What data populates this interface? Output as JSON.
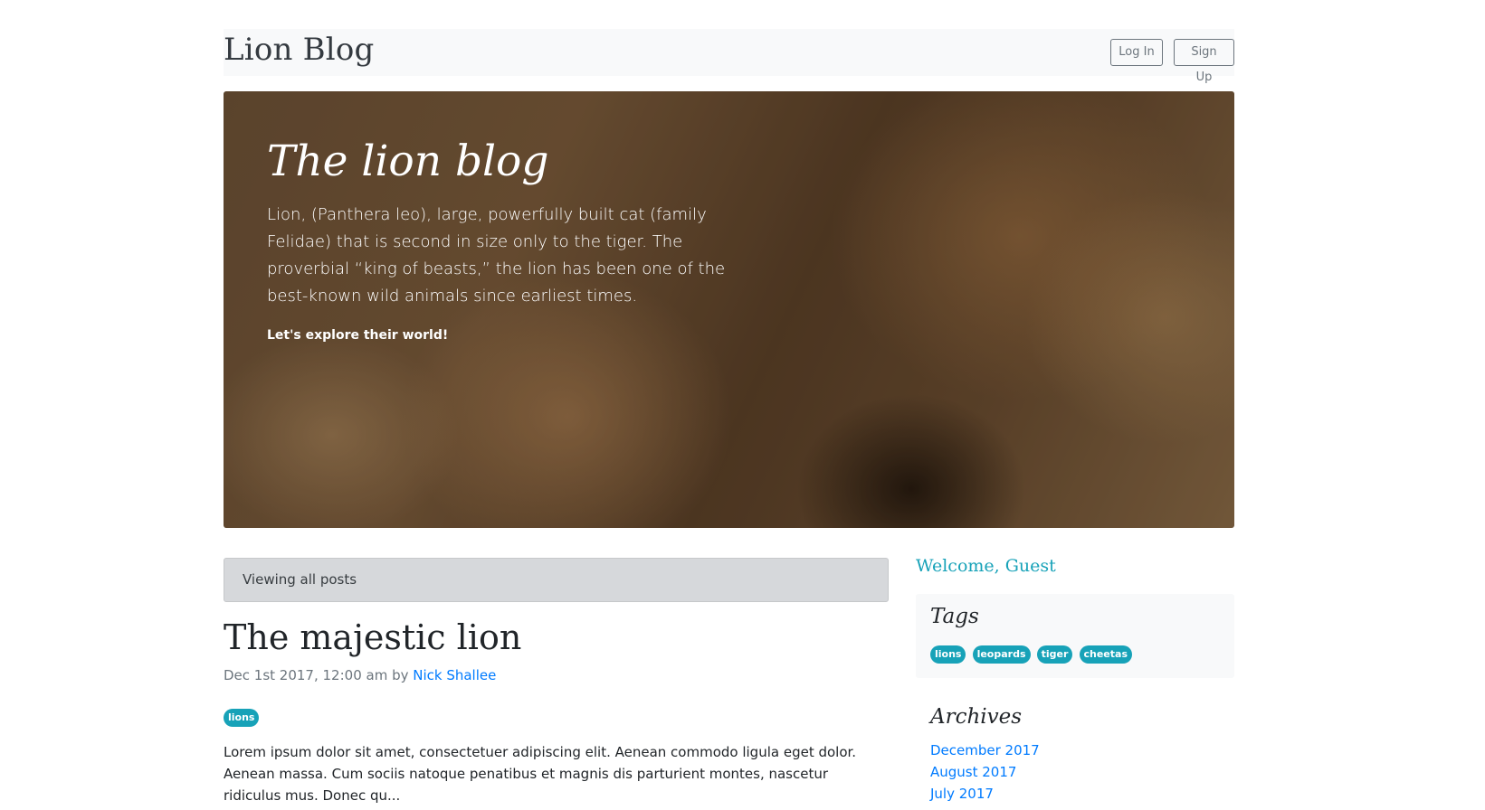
{
  "header": {
    "brand": "Lion Blog",
    "login_label": "Log In",
    "signup_label": "Sign Up"
  },
  "hero": {
    "title": "The lion blog",
    "text": "Lion, (Panthera leo), large, powerfully built cat (family Felidae) that is second in size only to the tiger. The proverbial “king of beasts,” the lion has been one of the best-known wild animals since earliest times.",
    "cta": "Let's explore their world!"
  },
  "main": {
    "viewing_text": "Viewing all posts",
    "post": {
      "title": "The majestic lion",
      "date": "Dec 1st 2017, 12:00 am by ",
      "author": "Nick Shallee",
      "tag": "lions",
      "excerpt": "Lorem ipsum dolor sit amet, consectetuer adipiscing elit. Aenean commodo ligula eget dolor. Aenean massa. Cum sociis natoque penatibus et magnis dis parturient montes, nascetur ridiculus mus. Donec qu..."
    }
  },
  "sidebar": {
    "welcome": "Welcome, Guest",
    "tags_title": "Tags",
    "tags": [
      "lions",
      "leopards",
      "tiger",
      "cheetas"
    ],
    "archives_title": "Archives",
    "archives": [
      "December 2017",
      "August 2017",
      "July 2017"
    ]
  },
  "colors": {
    "accent": "#17a2b8",
    "link": "#007bff",
    "header_bg": "#f8f9fa"
  }
}
